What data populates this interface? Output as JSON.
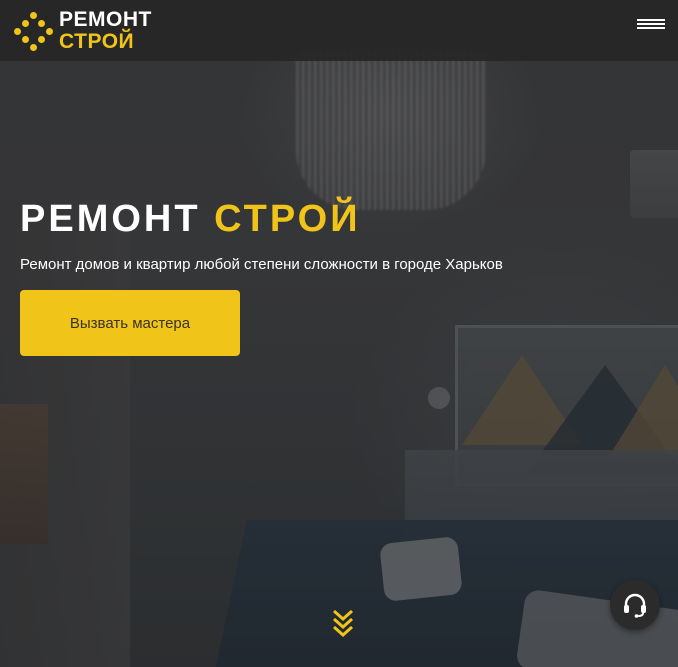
{
  "header": {
    "logo": {
      "line1": "РЕМОНТ",
      "line2": "СТРОЙ",
      "icon": "dots-diamond-logo-icon"
    },
    "menu_icon": "hamburger-menu-icon"
  },
  "hero": {
    "title_part1": "РЕМОНТ",
    "title_part2": "СТРОЙ",
    "subtitle": "Ремонт домов и квартир любой степени сложности в городе Харьков",
    "cta_label": "Вызвать мастера",
    "scroll_icon": "double-chevron-down-icon",
    "support_icon": "headset-icon"
  },
  "colors": {
    "accent": "#f0c419",
    "header_bg": "#262626",
    "text": "#ffffff",
    "button_text": "#3a3324"
  }
}
